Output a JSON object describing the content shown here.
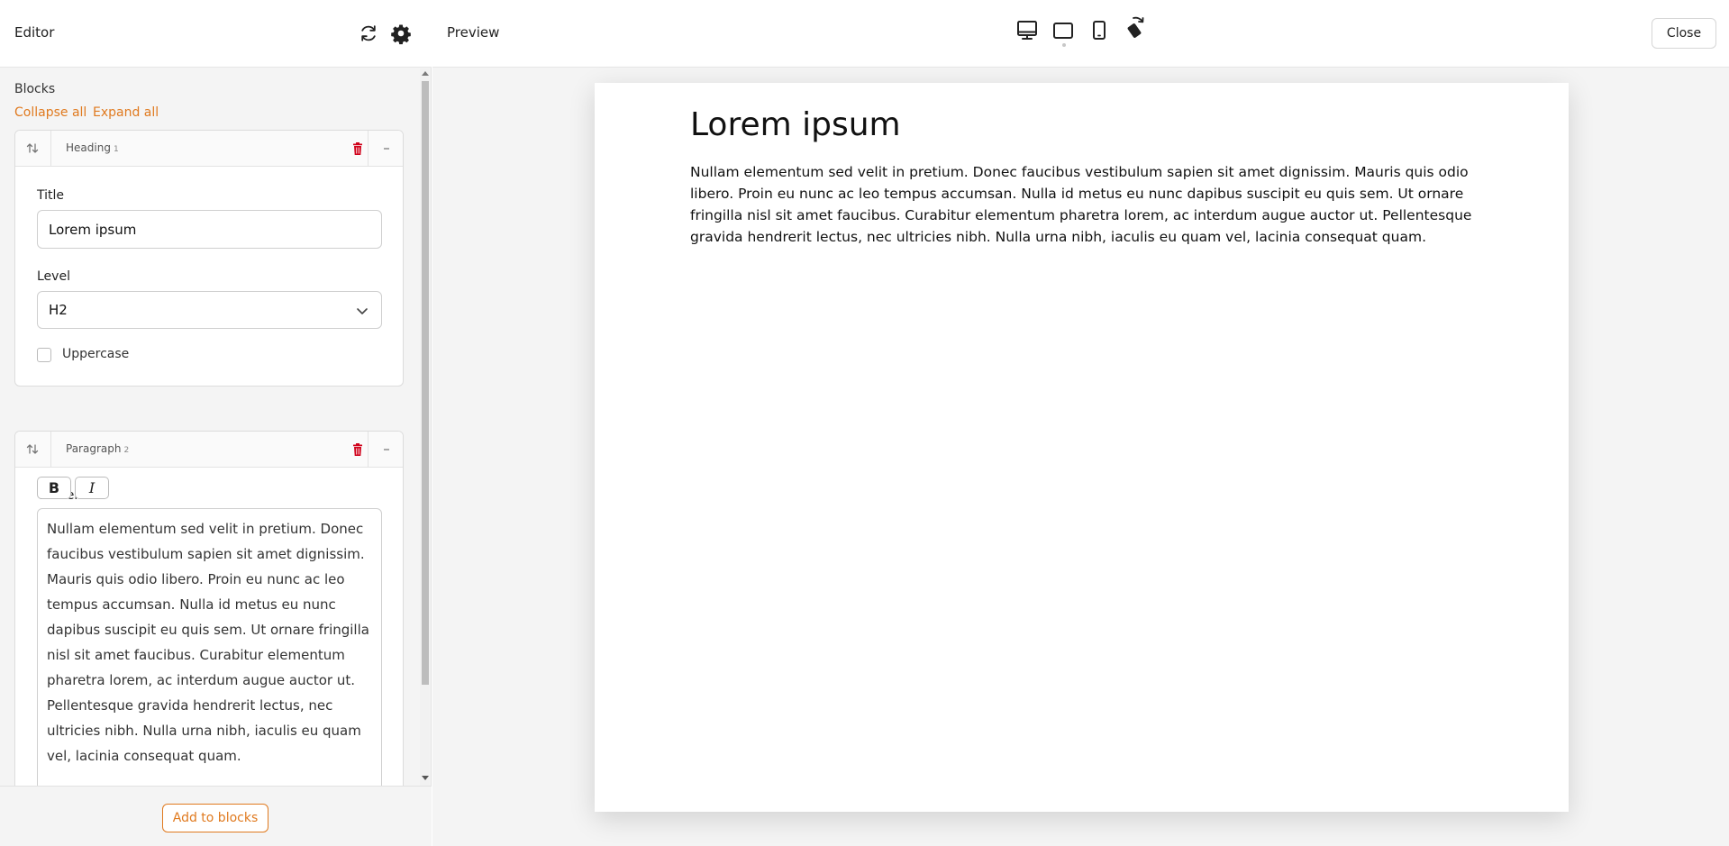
{
  "editor": {
    "title": "Editor",
    "blocks_label": "Blocks",
    "collapse_all": "Collapse all",
    "expand_all": "Expand all",
    "add_to_blocks": "Add to blocks",
    "blocks": [
      {
        "type": "Heading",
        "number": "1",
        "fields": {
          "title_label": "Title",
          "title_value": "Lorem ipsum",
          "level_label": "Level",
          "level_value": "H2",
          "uppercase_label": "Uppercase",
          "uppercase_checked": false
        }
      },
      {
        "type": "Paragraph",
        "number": "2",
        "fields": {
          "content_label": "Content",
          "bold_label": "B",
          "italic_label": "I",
          "content_value": "Nullam elementum sed velit in pretium. Donec faucibus vestibulum sapien sit amet dignissim. Mauris quis odio libero. Proin eu nunc ac leo tempus accumsan. Nulla id metus eu nunc dapibus suscipit eu quis sem. Ut ornare fringilla nisl sit amet faucibus. Curabitur elementum pharetra lorem, ac interdum augue auctor ut. Pellentesque gravida hendrerit lectus, nec ultricies nibh. Nulla urna nibh, iaculis eu quam vel, lacinia consequat quam."
        }
      }
    ],
    "icons": [
      "refresh-icon",
      "gear-icon",
      "sort-arrows-icon",
      "trash-icon",
      "minus-icon",
      "chevron-down-icon"
    ]
  },
  "preview": {
    "title": "Preview",
    "close_label": "Close",
    "devices": [
      "desktop-icon",
      "tablet-icon",
      "mobile-icon",
      "rotate-icon"
    ],
    "active_device": "tablet",
    "heading": "Lorem ipsum",
    "paragraph": "Nullam elementum sed velit in pretium. Donec faucibus vestibulum sapien sit amet dignissim. Mauris quis odio libero. Proin eu nunc ac leo tempus accumsan. Nulla id metus eu nunc dapibus suscipit eu quis sem. Ut ornare fringilla nisl sit amet faucibus. Curabitur elementum pharetra lorem, ac interdum augue auctor ut. Pellentesque gravida hendrerit lectus, nec ultricies nibh. Nulla urna nibh, iaculis eu quam vel, lacinia consequat quam."
  },
  "colors": {
    "accent": "#e07a1f",
    "danger": "#d0021b"
  }
}
